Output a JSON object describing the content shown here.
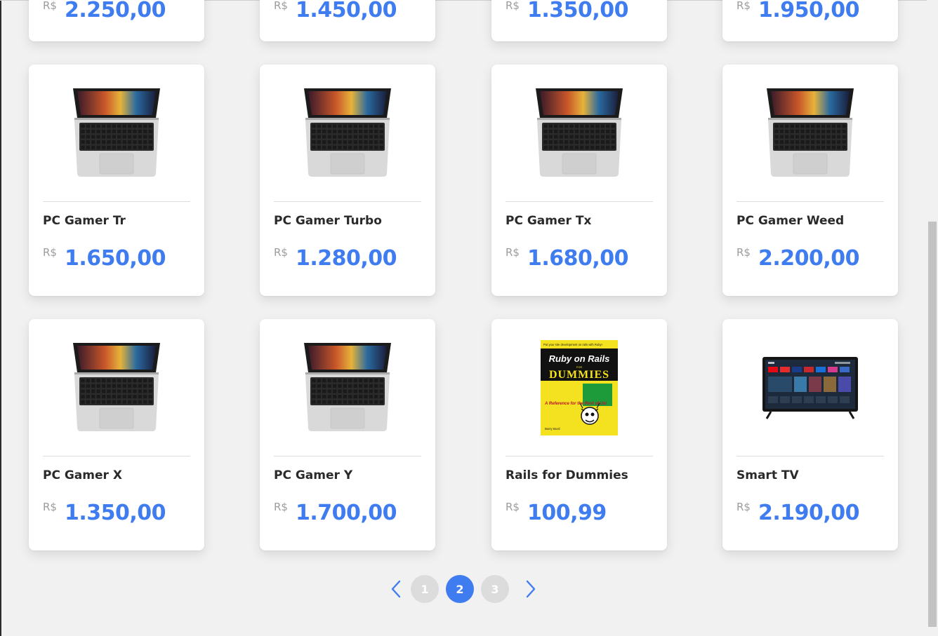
{
  "products": [
    {
      "name": "",
      "currency": "R$",
      "price": "2.250,00",
      "image": "laptop"
    },
    {
      "name": "",
      "currency": "R$",
      "price": "1.450,00",
      "image": "laptop"
    },
    {
      "name": "",
      "currency": "R$",
      "price": "1.350,00",
      "image": "laptop"
    },
    {
      "name": "",
      "currency": "R$",
      "price": "1.950,00",
      "image": "laptop"
    },
    {
      "name": "PC Gamer Tr",
      "currency": "R$",
      "price": "1.650,00",
      "image": "laptop"
    },
    {
      "name": "PC Gamer Turbo",
      "currency": "R$",
      "price": "1.280,00",
      "image": "laptop"
    },
    {
      "name": "PC Gamer Tx",
      "currency": "R$",
      "price": "1.680,00",
      "image": "laptop"
    },
    {
      "name": "PC Gamer Weed",
      "currency": "R$",
      "price": "2.200,00",
      "image": "laptop"
    },
    {
      "name": "PC Gamer X",
      "currency": "R$",
      "price": "1.350,00",
      "image": "laptop"
    },
    {
      "name": "PC Gamer Y",
      "currency": "R$",
      "price": "1.700,00",
      "image": "laptop"
    },
    {
      "name": "Rails for Dummies",
      "currency": "R$",
      "price": "100,99",
      "image": "book"
    },
    {
      "name": "Smart TV",
      "currency": "R$",
      "price": "2.190,00",
      "image": "tv"
    }
  ],
  "book_cover": {
    "top_line": "Put your site development on rails with Ruby!",
    "title": "Ruby on Rails",
    "for_text": "FOR",
    "dummies": "DUMMIES",
    "reference": "A Reference for the Rest of Us!",
    "author": "Barry Burd"
  },
  "pagination": {
    "pages": [
      "1",
      "2",
      "3"
    ],
    "current": "2",
    "prev_icon": "chevron-left-icon",
    "next_icon": "chevron-right-icon"
  },
  "colors": {
    "accent": "#3f7cf0",
    "page_bg": "#f1f1f1",
    "inactive_page": "#dcdcdc"
  }
}
